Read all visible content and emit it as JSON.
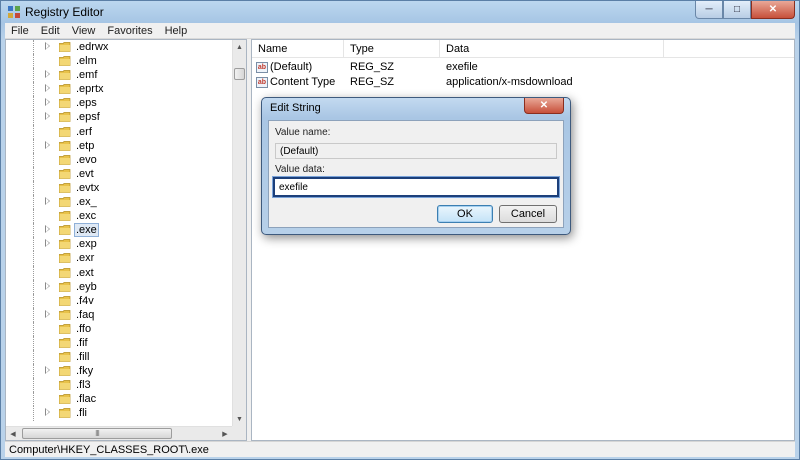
{
  "window": {
    "title": "Registry Editor",
    "controls": {
      "minimize": "─",
      "maximize": "□",
      "close": "✕"
    }
  },
  "menu": [
    "File",
    "Edit",
    "View",
    "Favorites",
    "Help"
  ],
  "tree": {
    "items": [
      {
        "label": ".edrwx",
        "expandable": true
      },
      {
        "label": ".elm",
        "expandable": false
      },
      {
        "label": ".emf",
        "expandable": true
      },
      {
        "label": ".eprtx",
        "expandable": true
      },
      {
        "label": ".eps",
        "expandable": true
      },
      {
        "label": ".epsf",
        "expandable": true
      },
      {
        "label": ".erf",
        "expandable": false
      },
      {
        "label": ".etp",
        "expandable": true
      },
      {
        "label": ".evo",
        "expandable": false
      },
      {
        "label": ".evt",
        "expandable": false
      },
      {
        "label": ".evtx",
        "expandable": false
      },
      {
        "label": ".ex_",
        "expandable": true
      },
      {
        "label": ".exc",
        "expandable": false
      },
      {
        "label": ".exe",
        "expandable": true,
        "selected": true
      },
      {
        "label": ".exp",
        "expandable": true
      },
      {
        "label": ".exr",
        "expandable": false
      },
      {
        "label": ".ext",
        "expandable": false
      },
      {
        "label": ".eyb",
        "expandable": true
      },
      {
        "label": ".f4v",
        "expandable": false
      },
      {
        "label": ".faq",
        "expandable": true
      },
      {
        "label": ".ffo",
        "expandable": false
      },
      {
        "label": ".fif",
        "expandable": false
      },
      {
        "label": ".fill",
        "expandable": false
      },
      {
        "label": ".fky",
        "expandable": true
      },
      {
        "label": ".fl3",
        "expandable": false
      },
      {
        "label": ".flac",
        "expandable": false
      },
      {
        "label": ".fli",
        "expandable": true
      }
    ],
    "scroll_glyphs": {
      "up": "▲",
      "down": "▼",
      "left": "◀",
      "right": "▶",
      "grip": "III"
    }
  },
  "list": {
    "headers": {
      "name": "Name",
      "type": "Type",
      "data": "Data"
    },
    "rows": [
      {
        "icon": "ab",
        "name": "(Default)",
        "type": "REG_SZ",
        "data": "exefile"
      },
      {
        "icon": "ab",
        "name": "Content Type",
        "type": "REG_SZ",
        "data": "application/x-msdownload"
      }
    ]
  },
  "status": {
    "path": "Computer\\HKEY_CLASSES_ROOT\\.exe"
  },
  "dialog": {
    "title": "Edit String",
    "close": "✕",
    "value_name_label": "Value name:",
    "value_name": "(Default)",
    "value_data_label": "Value data:",
    "value_data": "exefile",
    "ok_label": "OK",
    "cancel_label": "Cancel"
  },
  "colors": {
    "accent": "#1c3f7a",
    "title_gradient_top": "#bcd7ef",
    "close_red": "#c7503a",
    "folder": "#e8c24a"
  },
  "icons": {
    "app": "registry-icon",
    "folder": "folder-icon",
    "string_value": "string-value-icon"
  }
}
